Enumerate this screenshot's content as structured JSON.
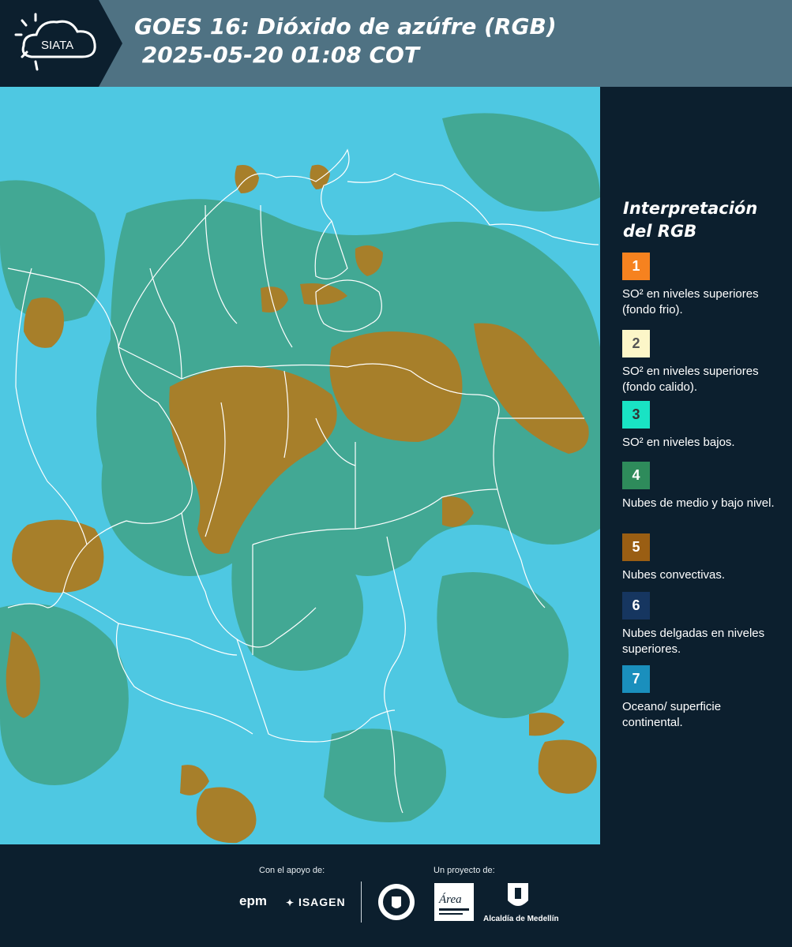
{
  "header": {
    "logo_text": "SIATA",
    "title": "GOES 16: Dióxido de azúfre (RGB)\n 2025-05-20 01:08 COT"
  },
  "legend": {
    "title": "Interpretación del RGB",
    "items": [
      {
        "number": "1",
        "color": "#f6821f",
        "number_color": "#ffffff",
        "text": "SO² en niveles superiores (fondo frio)."
      },
      {
        "number": "2",
        "color": "#fcf6c8",
        "number_color": "#555555",
        "text": "SO² en niveles superiores (fondo calido)."
      },
      {
        "number": "3",
        "color": "#19e3c4",
        "number_color": "#333333",
        "text": "SO² en niveles bajos."
      },
      {
        "number": "4",
        "color": "#2e8b5b",
        "number_color": "#ffffff",
        "text": "Nubes de medio y bajo nivel."
      },
      {
        "number": "5",
        "color": "#9a5e13",
        "number_color": "#ffffff",
        "text": "Nubes convectivas."
      },
      {
        "number": "6",
        "color": "#163660",
        "number_color": "#ffffff",
        "text": "Nubes delgadas en niveles superiores."
      },
      {
        "number": "7",
        "color": "#1a8fbd",
        "number_color": "#ffffff",
        "text": "Oceano/ superficie continental."
      }
    ]
  },
  "footer": {
    "support_label": "Con el apoyo de:",
    "project_label": "Un proyecto de:",
    "sponsors": [
      "epm",
      "ISAGEN"
    ],
    "partners": [
      "Área Metropolitana",
      "Alcaldía de Medellín"
    ]
  },
  "map": {
    "ocean_color": "#4ec8e2",
    "land_color": "#3f9e7a",
    "cloud_color": "#a77f2a",
    "border_color": "#ffffff"
  }
}
